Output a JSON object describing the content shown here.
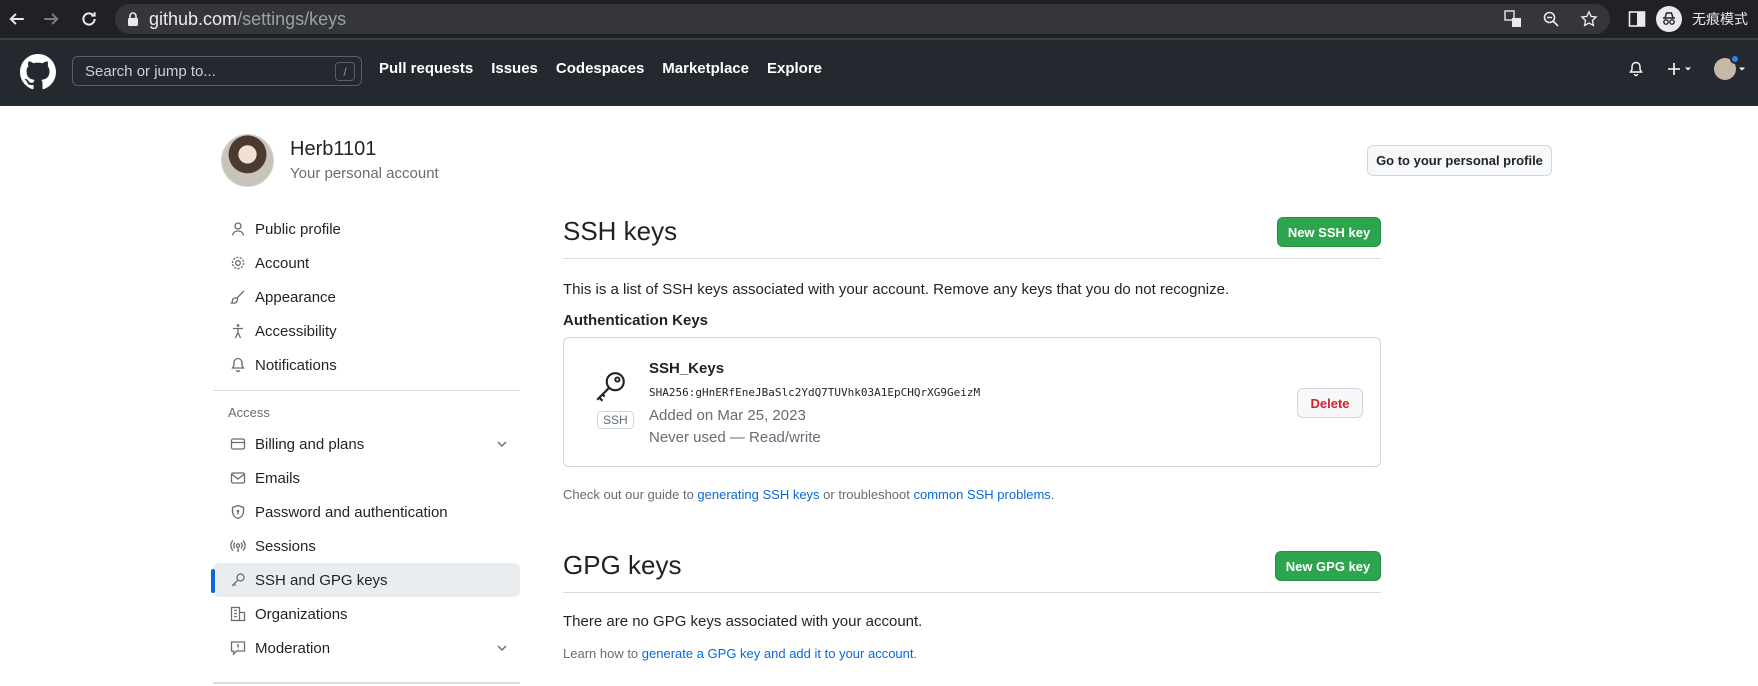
{
  "browser": {
    "url_host": "github.com",
    "url_path": "/settings/keys",
    "incognito_label": "无痕模式",
    "icons": [
      "back-icon",
      "forward-icon",
      "reload-icon",
      "lock-icon",
      "translate-icon",
      "zoom-icon",
      "star-icon",
      "side-panel-icon",
      "incognito-icon"
    ]
  },
  "header": {
    "search_placeholder": "Search or jump to...",
    "search_shortcut": "/",
    "nav": [
      "Pull requests",
      "Issues",
      "Codespaces",
      "Marketplace",
      "Explore"
    ],
    "icons": [
      "github-logo-icon",
      "bell-icon",
      "plus-icon",
      "avatar-icon"
    ]
  },
  "profile": {
    "name": "Herb1101",
    "subtitle": "Your personal account",
    "profile_button": "Go to your personal profile"
  },
  "sidebar": {
    "items_top": [
      {
        "label": "Public profile",
        "icon": "person-icon"
      },
      {
        "label": "Account",
        "icon": "gear-icon"
      },
      {
        "label": "Appearance",
        "icon": "paintbrush-icon"
      },
      {
        "label": "Accessibility",
        "icon": "accessibility-icon"
      },
      {
        "label": "Notifications",
        "icon": "bell-icon"
      }
    ],
    "access_heading": "Access",
    "items_access": [
      {
        "label": "Billing and plans",
        "icon": "credit-card-icon",
        "expandable": true
      },
      {
        "label": "Emails",
        "icon": "mail-icon"
      },
      {
        "label": "Password and authentication",
        "icon": "shield-icon"
      },
      {
        "label": "Sessions",
        "icon": "broadcast-icon"
      },
      {
        "label": "SSH and GPG keys",
        "icon": "key-icon",
        "active": true
      },
      {
        "label": "Organizations",
        "icon": "organization-icon"
      },
      {
        "label": "Moderation",
        "icon": "report-icon",
        "expandable": true
      }
    ]
  },
  "ssh": {
    "title": "SSH keys",
    "new_button": "New SSH key",
    "description": "This is a list of SSH keys associated with your account. Remove any keys that you do not recognize.",
    "auth_heading": "Authentication Keys",
    "key": {
      "name": "SSH_Keys",
      "fingerprint": "SHA256:gHnERfEneJBaSlc2YdQ7TUVhk03A1EpCHQrXG9GeizM",
      "added": "Added on Mar 25, 2023",
      "usage": "Never used — Read/write",
      "badge": "SSH",
      "delete_button": "Delete"
    },
    "guide_prefix": "Check out our guide to ",
    "guide_link1": "generating SSH keys",
    "guide_middle": " or troubleshoot ",
    "guide_link2": "common SSH problems",
    "guide_suffix": "."
  },
  "gpg": {
    "title": "GPG keys",
    "new_button": "New GPG key",
    "empty_text": "There are no GPG keys associated with your account.",
    "learn_prefix": "Learn how to ",
    "learn_link": "generate a GPG key and add it to your account",
    "learn_suffix": "."
  },
  "colors": {
    "primary_button": "#2da44e",
    "link": "#0969da",
    "danger": "#cf222e",
    "header_bg": "#24292f",
    "active_indicator": "#0969da"
  }
}
